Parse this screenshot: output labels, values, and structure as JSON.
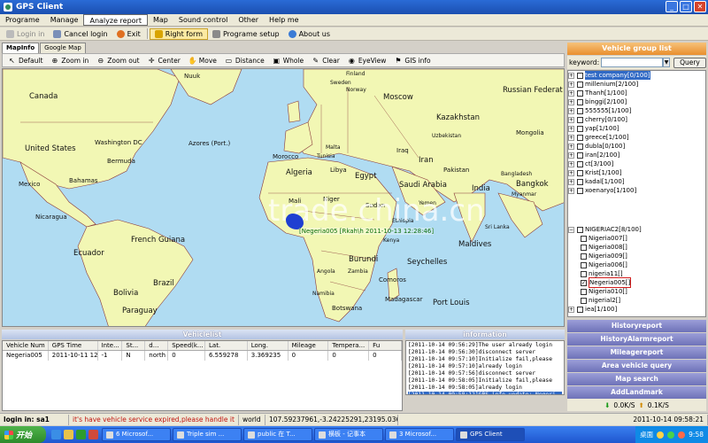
{
  "window": {
    "title": "GPS Client",
    "min": "_",
    "max": "□",
    "close": "✕"
  },
  "menu": [
    "Programe",
    "Manage",
    "Analyze report",
    "Map",
    "Sound control",
    "Other",
    "Help me"
  ],
  "toolbar": [
    "Login in",
    "Cancel login",
    "Exit",
    "Right form",
    "Programe setup",
    "About us"
  ],
  "map_tabs": [
    "MapInfo",
    "Google Map"
  ],
  "map_tools": [
    "Default",
    "Zoom in",
    "Zoom out",
    "Center",
    "Move",
    "Distance",
    "Whole",
    "Clear",
    "EyeView",
    "GIS info"
  ],
  "places": {
    "canada": "Canada",
    "us": "United States",
    "washington": "Washington DC",
    "bermuda": "Bermuda",
    "mexico": "Mexico",
    "bahamas": "Bahamas",
    "azores": "Azores (Port.)",
    "nuuk": "Nuuk",
    "norway": "Norway",
    "moscow": "Moscow",
    "russia": "Russian Federat",
    "kazakhstan": "Kazakhstan",
    "morocco": "Morocco",
    "algeria": "Algeria",
    "libya": "Libya",
    "egypt": "Egypt",
    "iran": "Iran",
    "saudi": "Saudi Arabia",
    "india": "India",
    "bangkok": "Bangkok",
    "maldives": "Maldives",
    "burundi": "Burundi",
    "seychelles": "Seychelles",
    "comoros": "Comoros",
    "botswana": "Botswana",
    "madagascar": "Madagascar",
    "portlouis": "Port Louis",
    "guyana": "French Guiana",
    "ecuador": "Ecuador",
    "brazil": "Brazil",
    "bolivia": "Bolivia",
    "paraguay": "Paraguay",
    "nicaragua": "Nicaragua",
    "mali": "Mali",
    "niger": "Niger",
    "sudan": "Sudan",
    "tunisia": "Tunisia",
    "malta": "Malta",
    "iraq": "Iraq",
    "uzbekistan": "Uzbekistan",
    "pakistan": "Pakistan",
    "finland": "Finland",
    "sweden": "Sweden",
    "mongolia": "Mongolia",
    "yemen": "Yemen",
    "ethiopia": "Ethiopia",
    "kenya": "Kenya",
    "bangladesh": "Bangladesh",
    "myanmar": "Myanmar",
    "srilanka": "Sri Lanka",
    "angola": "Angola",
    "namibia": "Namibia",
    "zambia": "Zambia"
  },
  "watermark": "trade.china.cn",
  "vehicle_label": "[Negeria005 [Rkah\\h 2011-10-13 12:28:46]",
  "right_panel": {
    "header": "Vehicle group list",
    "keyword_label": "keyword:",
    "keyword_value": "",
    "query": "Query",
    "groups": [
      {
        "label": "test company[0/100]",
        "selected": true
      },
      {
        "label": "millenium[2/100]"
      },
      {
        "label": "Thanh[1/100]"
      },
      {
        "label": "binggi[2/100]"
      },
      {
        "label": "555555[1/100]"
      },
      {
        "label": "cherry[0/100]"
      },
      {
        "label": "yap[1/100]"
      },
      {
        "label": "greece[1/100]"
      },
      {
        "label": "dubla[0/100]"
      },
      {
        "label": "iran[2/100]"
      },
      {
        "label": "ct[3/100]"
      },
      {
        "label": "Krist[1/100]"
      },
      {
        "label": "kadal[1/100]"
      },
      {
        "label": "xoenaryo[1/100]"
      }
    ],
    "nigeria_group": "NIGERIAC2[8/100]",
    "vehicles": [
      "Nigeria007[]",
      "Nigeria008[]",
      "Nigeria009[]",
      "Nigeria006[]",
      "nigeria11[]",
      "Negeria005[]",
      "Nigeria010[]",
      "nigerial2[]"
    ],
    "last_group": "iea[1/100]",
    "tabs": [
      "Historyreport",
      "HistoryAlarmreport",
      "Mileagereport",
      "Area vehicle query",
      "Map search",
      "AddLandmark"
    ],
    "speed_down": "0.0K/S",
    "speed_up": "0.1K/S"
  },
  "vehicle_list": {
    "title": "Vehiclelist",
    "headers": [
      "Vehicle Num",
      "GPS Time",
      "Inte...",
      "St...",
      "d...",
      "Speed(k...",
      "Lat.",
      "Long.",
      "Mileage",
      "Tempera...",
      "Fu"
    ],
    "rows": [
      [
        "Negeria005",
        "2011-10-11 12",
        "-1",
        "N",
        "north",
        "0",
        "6.559278",
        "3.369235",
        "0",
        "0",
        "0"
      ]
    ]
  },
  "information": {
    "title": "information",
    "lines": [
      "[2011-10-14 09:56:29]The user already login",
      "[2011-10-14 09:56:30]disconnect server",
      "[2011-10-14 09:57:10]Initialize fail,please",
      "[2011-10-14 09:57:10]already login",
      "[2011-10-14 09:57:56]disconnect server",
      "[2011-10-14 09:58:05]Initialize fail,please",
      "[2011-10-14 09:58:05]already login",
      "[2011-10-14 09:58:12]GPS info update: Negeri"
    ]
  },
  "status": {
    "login": "login in: sa1",
    "warning": "it's have vehicle service expired,please handle it",
    "scope": "world",
    "coords": "107.59237961,-3.24225291,23195.0369m",
    "datetime": "2011-10-14 09:58:21"
  },
  "taskbar": {
    "start": "开始",
    "tasks": [
      "6 Microsof...",
      "Triple sim ...",
      "public 在 T...",
      "横板 - 记事本",
      "3 Microsof...",
      "GPS Client"
    ],
    "tray_text": "桌面",
    "clock": "9:58"
  },
  "colors": {
    "title": "#1b4fb0",
    "accent": "#e98f2e",
    "sea": "#b0dcf2",
    "land": "#f2f7b4",
    "tab": "#6e72b8"
  }
}
